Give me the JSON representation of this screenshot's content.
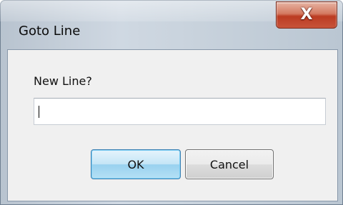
{
  "window": {
    "title": "Goto Line",
    "close_glyph": "X"
  },
  "form": {
    "prompt_label": "New Line?",
    "line_input_value": "",
    "line_input_placeholder": ""
  },
  "buttons": {
    "ok_label": "OK",
    "cancel_label": "Cancel"
  },
  "colors": {
    "client_bg": "#f0f0f0",
    "close_red": "#c8553b",
    "default_button_blue": "#98d1ef"
  },
  "icons": {
    "close": "close-icon"
  }
}
